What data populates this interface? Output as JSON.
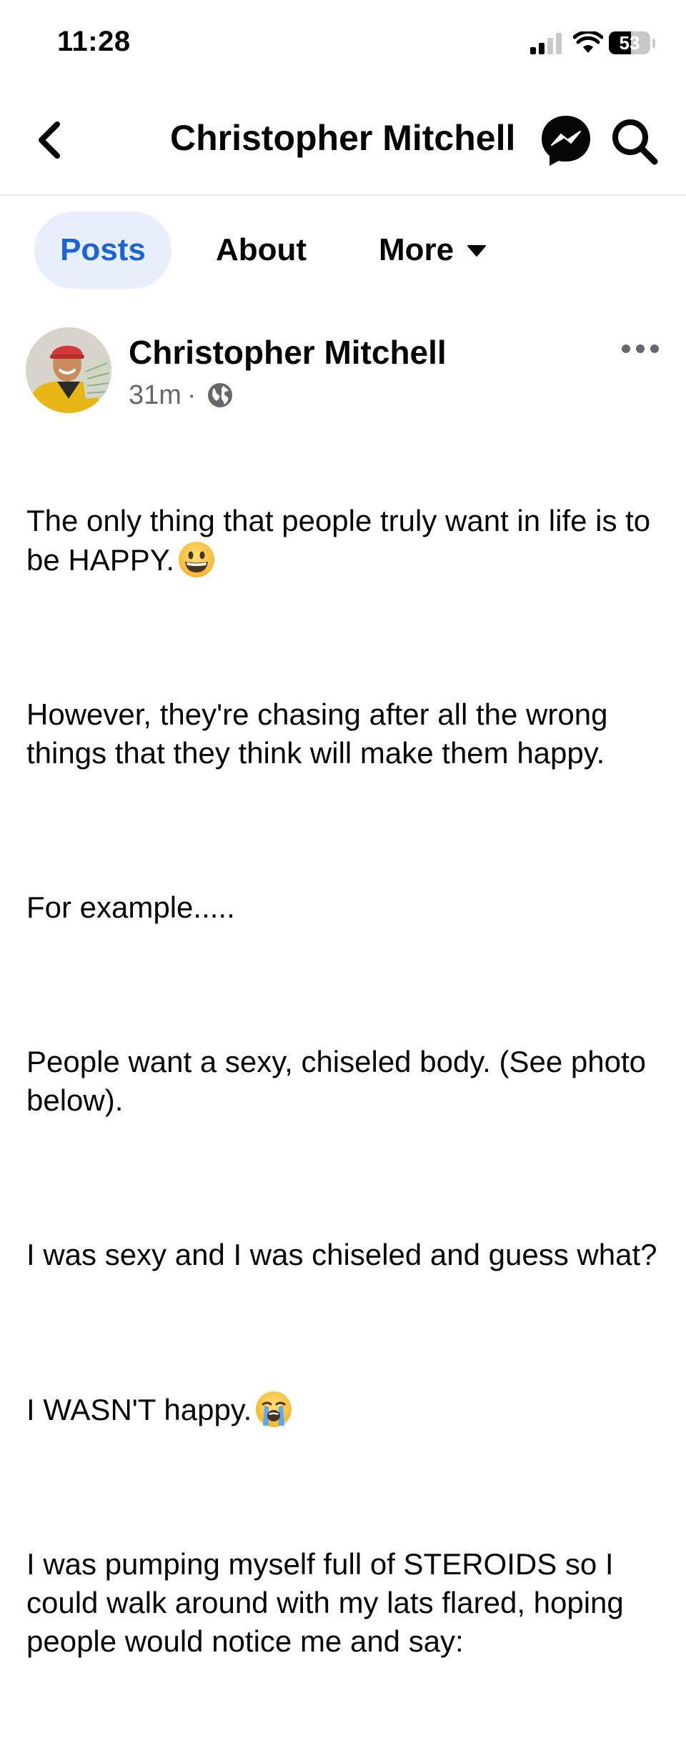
{
  "status_bar": {
    "time": "11:28",
    "battery_text": "53",
    "battery_level": 0.53
  },
  "header": {
    "title": "Christopher Mitchell",
    "icons": [
      "back-icon",
      "messenger-icon",
      "search-icon"
    ]
  },
  "tabs": [
    {
      "label": "Posts",
      "active": true
    },
    {
      "label": "About",
      "active": false
    },
    {
      "label": "More",
      "active": false
    }
  ],
  "post": {
    "author": "Christopher Mitchell",
    "time": "31m",
    "separator": "·",
    "audience_icon": "globe-icon",
    "paragraphs": [
      {
        "text": "The only thing that people truly want in life is to be HAPPY.",
        "emoji": "grinning-face"
      },
      {
        "text": "However, they're chasing after all the wrong things that they think will make them happy."
      },
      {
        "text": "For example....."
      },
      {
        "text": "People want a sexy, chiseled body. (See photo below)."
      },
      {
        "text": "I was sexy and I was chiseled and guess what?"
      },
      {
        "text": "I WASN'T happy.",
        "emoji": "loudly-crying-face"
      },
      {
        "text": "I was pumping myself full of STEROIDS so I could walk around with my lats flared, hoping people would notice me and say:"
      }
    ]
  },
  "colors": {
    "accent": "#1e63d6",
    "active_tab_bg": "#e7effc",
    "secondary_text": "#65676b",
    "divider": "#e4e6eb"
  }
}
